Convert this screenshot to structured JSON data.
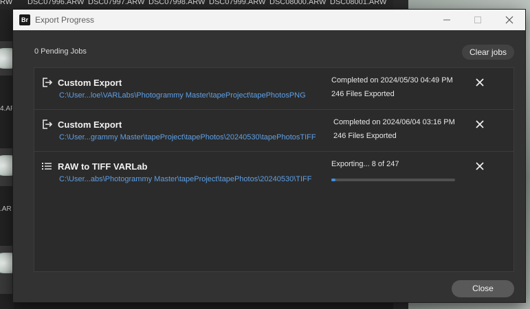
{
  "background": {
    "top_strip_files": [
      "RW",
      "DSC07996.ARW",
      "DSC07997.ARW",
      "DSC07998.ARW",
      "DSC07999.ARW",
      "DSC08000.ARW",
      "DSC08001.ARW"
    ],
    "side_labels": [
      "4.AR",
      ".AR"
    ]
  },
  "dialog": {
    "app_badge": "Br",
    "title": "Export Progress",
    "pending": "0 Pending Jobs",
    "clear_label": "Clear jobs",
    "close_label": "Close"
  },
  "jobs": [
    {
      "icon": "export-icon",
      "title": "Custom Export",
      "path": "C:\\User...loe\\VARLabs\\Photogrammy Master\\tapeProject\\tapePhotosPNG",
      "status": "Completed on 2024/05/30 04:49 PM",
      "files": "246 Files Exported"
    },
    {
      "icon": "export-icon",
      "title": "Custom Export",
      "path": "C:\\User...grammy Master\\tapeProject\\tapePhotos\\20240530\\tapePhotosTIFF",
      "status": "Completed on 2024/06/04 03:16 PM",
      "files": "246 Files Exported"
    },
    {
      "icon": "list-icon",
      "title": "RAW to TIFF VARLab",
      "path": "C:\\User...abs\\Photogrammy Master\\tapeProject\\tapePhotos\\20240530\\TIFF",
      "status": "Exporting... 8 of 247",
      "progress": 0.032
    }
  ],
  "colors": {
    "accent": "#3f8fe0",
    "path_link": "#5ea0e6",
    "dialog_bg": "#323232",
    "titlebar_bg": "#f3f3f3"
  }
}
